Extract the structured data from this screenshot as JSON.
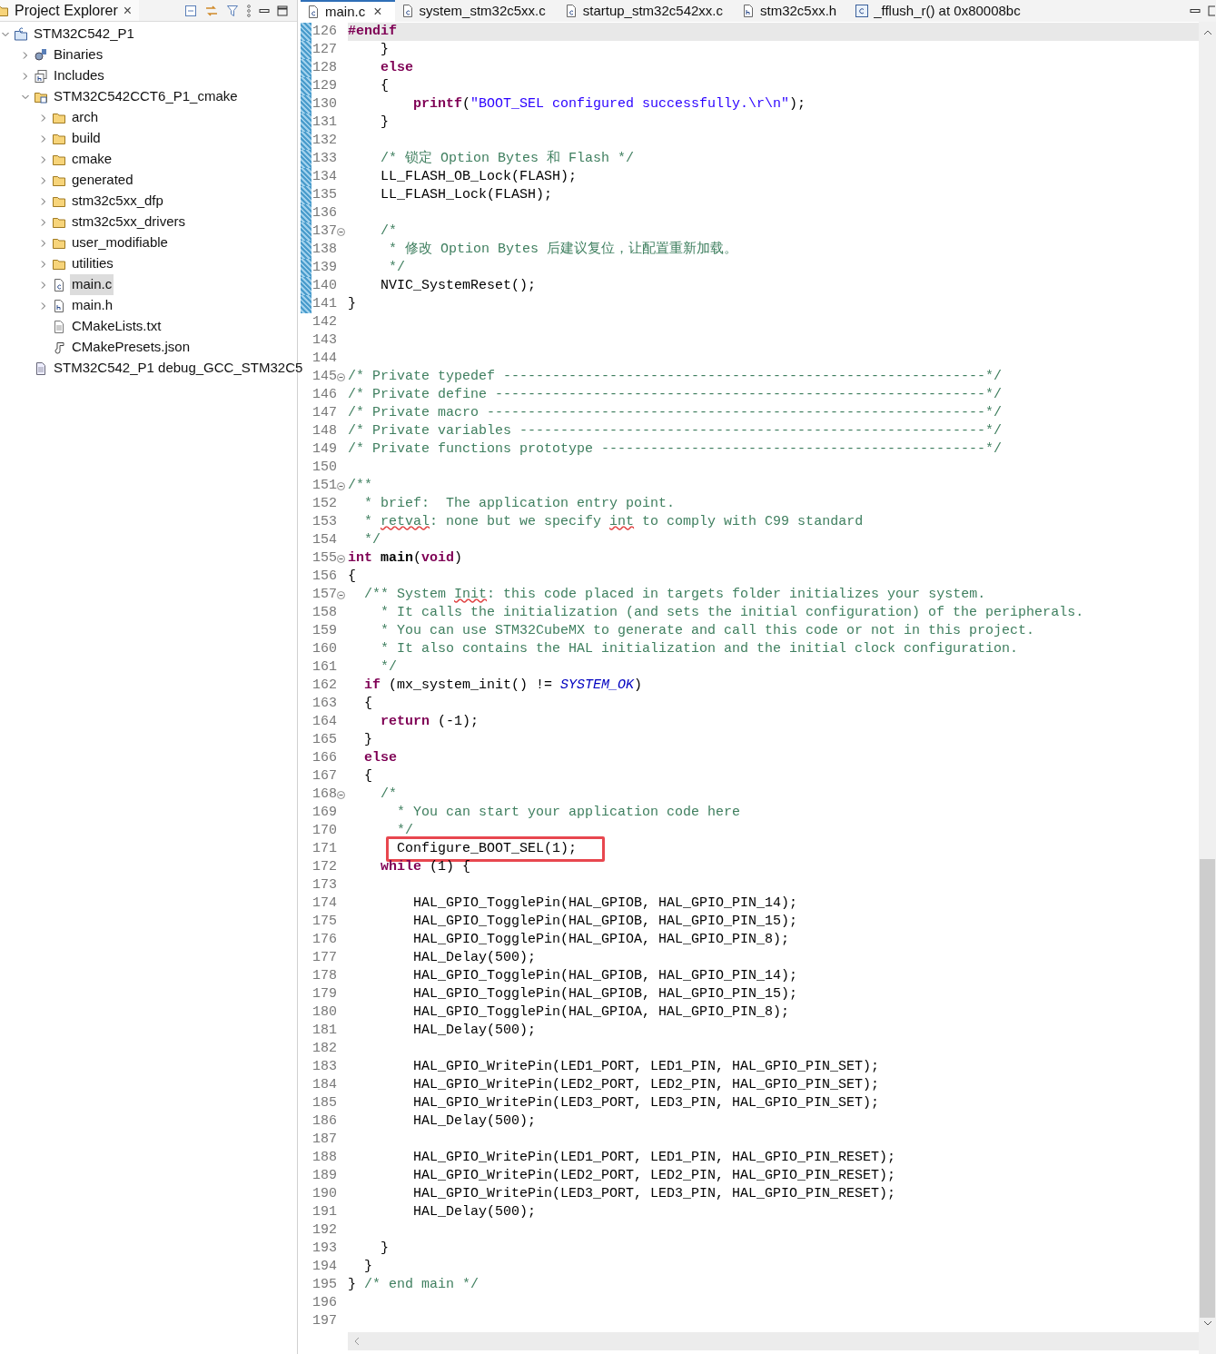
{
  "explorer": {
    "title": "Project Explorer",
    "close": "×",
    "tree": [
      {
        "label": "STM32C542_P1",
        "kind": "project",
        "expanded": true,
        "selected": false,
        "children": [
          {
            "label": "Binaries",
            "kind": "binaries",
            "expanded": false,
            "selected": false
          },
          {
            "label": "Includes",
            "kind": "includes",
            "expanded": false,
            "selected": false
          },
          {
            "label": "STM32C542CCT6_P1_cmake",
            "kind": "source-folder",
            "expanded": true,
            "selected": false,
            "children": [
              {
                "label": "arch",
                "kind": "folder",
                "expanded": false,
                "selected": false
              },
              {
                "label": "build",
                "kind": "folder",
                "expanded": false,
                "selected": false
              },
              {
                "label": "cmake",
                "kind": "folder",
                "expanded": false,
                "selected": false
              },
              {
                "label": "generated",
                "kind": "folder",
                "expanded": false,
                "selected": false
              },
              {
                "label": "stm32c5xx_dfp",
                "kind": "folder",
                "expanded": false,
                "selected": false
              },
              {
                "label": "stm32c5xx_drivers",
                "kind": "folder",
                "expanded": false,
                "selected": false
              },
              {
                "label": "user_modifiable",
                "kind": "folder",
                "expanded": false,
                "selected": false
              },
              {
                "label": "utilities",
                "kind": "folder",
                "expanded": false,
                "selected": false
              },
              {
                "label": "main.c",
                "kind": "c-file",
                "expanded": false,
                "selected": true
              },
              {
                "label": "main.h",
                "kind": "h-file",
                "expanded": false,
                "selected": false
              },
              {
                "label": "CMakeLists.txt",
                "kind": "text-file",
                "selected": false
              },
              {
                "label": "CMakePresets.json",
                "kind": "json-file",
                "selected": false
              }
            ]
          },
          {
            "label": "STM32C542_P1 debug_GCC_STM32C5",
            "kind": "launch-file",
            "selected": false
          }
        ]
      }
    ]
  },
  "editor": {
    "tabs": [
      {
        "label": "main.c",
        "kind": "c-file",
        "selected": true,
        "close": "×"
      },
      {
        "label": "system_stm32c5xx.c",
        "kind": "c-file",
        "selected": false
      },
      {
        "label": "startup_stm32c542xx.c",
        "kind": "c-file",
        "selected": false
      },
      {
        "label": "stm32c5xx.h",
        "kind": "h-file",
        "selected": false
      },
      {
        "label": "_fflush_r() at 0x80008bc",
        "kind": "disassembly",
        "selected": false
      }
    ],
    "lines": [
      {
        "n": "126",
        "fold": false,
        "changed": true,
        "current": true,
        "boxed": false,
        "tokens": [
          {
            "kind": "keyword",
            "text": "#endif"
          }
        ]
      },
      {
        "n": "127",
        "fold": false,
        "changed": true,
        "current": false,
        "boxed": false,
        "tokens": [
          {
            "kind": "plain",
            "text": "    }"
          }
        ]
      },
      {
        "n": "128",
        "fold": false,
        "changed": true,
        "current": false,
        "boxed": false,
        "tokens": [
          {
            "kind": "keyword",
            "text": "    else"
          }
        ]
      },
      {
        "n": "129",
        "fold": false,
        "changed": true,
        "current": false,
        "boxed": false,
        "tokens": [
          {
            "kind": "plain",
            "text": "    {"
          }
        ]
      },
      {
        "n": "130",
        "fold": false,
        "changed": true,
        "current": false,
        "boxed": false,
        "tokens": [
          {
            "kind": "keyword",
            "text": "        printf"
          },
          {
            "kind": "plain",
            "text": "("
          },
          {
            "kind": "string",
            "text": "\"BOOT_SEL configured successfully.\\r\\n\""
          },
          {
            "kind": "plain",
            "text": ");"
          }
        ]
      },
      {
        "n": "131",
        "fold": false,
        "changed": true,
        "current": false,
        "boxed": false,
        "tokens": [
          {
            "kind": "plain",
            "text": "    }"
          }
        ]
      },
      {
        "n": "132",
        "fold": false,
        "changed": true,
        "current": false,
        "boxed": false
      },
      {
        "n": "133",
        "fold": false,
        "changed": true,
        "current": false,
        "boxed": false,
        "tokens": [
          {
            "kind": "comment",
            "text": "    /* 锁定 Option Bytes 和 Flash */"
          }
        ]
      },
      {
        "n": "134",
        "fold": false,
        "changed": true,
        "current": false,
        "boxed": false,
        "tokens": [
          {
            "kind": "plain",
            "text": "    LL_FLASH_OB_Lock(FLASH);"
          }
        ]
      },
      {
        "n": "135",
        "fold": false,
        "changed": true,
        "current": false,
        "boxed": false,
        "tokens": [
          {
            "kind": "plain",
            "text": "    LL_FLASH_Lock(FLASH);"
          }
        ]
      },
      {
        "n": "136",
        "fold": false,
        "changed": true,
        "current": false,
        "boxed": false
      },
      {
        "n": "137",
        "fold": true,
        "changed": true,
        "current": false,
        "boxed": false,
        "tokens": [
          {
            "kind": "comment",
            "text": "    /*"
          }
        ]
      },
      {
        "n": "138",
        "fold": false,
        "changed": true,
        "current": false,
        "boxed": false,
        "tokens": [
          {
            "kind": "comment",
            "text": "     * 修改 Option Bytes 后建议复位，让配置重新加载。"
          }
        ]
      },
      {
        "n": "139",
        "fold": false,
        "changed": true,
        "current": false,
        "boxed": false,
        "tokens": [
          {
            "kind": "comment",
            "text": "     */"
          }
        ]
      },
      {
        "n": "140",
        "fold": false,
        "changed": true,
        "current": false,
        "boxed": false,
        "tokens": [
          {
            "kind": "plain",
            "text": "    NVIC_SystemReset();"
          }
        ]
      },
      {
        "n": "141",
        "fold": false,
        "changed": true,
        "current": false,
        "boxed": false,
        "tokens": [
          {
            "kind": "plain",
            "text": "}"
          }
        ]
      },
      {
        "n": "142",
        "fold": false,
        "changed": false,
        "current": false,
        "boxed": false
      },
      {
        "n": "143",
        "fold": false,
        "changed": false,
        "current": false,
        "boxed": false
      },
      {
        "n": "144",
        "fold": false,
        "changed": false,
        "current": false,
        "boxed": false
      },
      {
        "n": "145",
        "fold": true,
        "changed": false,
        "current": false,
        "boxed": false,
        "tokens": [
          {
            "kind": "comment",
            "text": "/* Private typedef -----------------------------------------------------------*/"
          }
        ]
      },
      {
        "n": "146",
        "fold": false,
        "changed": false,
        "current": false,
        "boxed": false,
        "tokens": [
          {
            "kind": "comment",
            "text": "/* Private define ------------------------------------------------------------*/"
          }
        ]
      },
      {
        "n": "147",
        "fold": false,
        "changed": false,
        "current": false,
        "boxed": false,
        "tokens": [
          {
            "kind": "comment",
            "text": "/* Private macro -------------------------------------------------------------*/"
          }
        ]
      },
      {
        "n": "148",
        "fold": false,
        "changed": false,
        "current": false,
        "boxed": false,
        "tokens": [
          {
            "kind": "comment",
            "text": "/* Private variables ---------------------------------------------------------*/"
          }
        ]
      },
      {
        "n": "149",
        "fold": false,
        "changed": false,
        "current": false,
        "boxed": false,
        "tokens": [
          {
            "kind": "comment",
            "text": "/* Private functions prototype -----------------------------------------------*/"
          }
        ]
      },
      {
        "n": "150",
        "fold": false,
        "changed": false,
        "current": false,
        "boxed": false
      },
      {
        "n": "151",
        "fold": true,
        "changed": false,
        "current": false,
        "boxed": false,
        "tokens": [
          {
            "kind": "comment",
            "text": "/**"
          }
        ]
      },
      {
        "n": "152",
        "fold": false,
        "changed": false,
        "current": false,
        "boxed": false,
        "tokens": [
          {
            "kind": "comment",
            "text": "  * brief:  The application entry point."
          }
        ]
      },
      {
        "n": "153",
        "fold": false,
        "changed": false,
        "current": false,
        "boxed": false,
        "tokens": [
          {
            "kind": "comment",
            "text": "  * "
          },
          {
            "kind": "typo",
            "text": "retval"
          },
          {
            "kind": "comment",
            "text": ": none but we specify "
          },
          {
            "kind": "typo",
            "text": "int"
          },
          {
            "kind": "comment",
            "text": " to comply with C99 standard"
          }
        ]
      },
      {
        "n": "154",
        "fold": false,
        "changed": false,
        "current": false,
        "boxed": false,
        "tokens": [
          {
            "kind": "comment",
            "text": "  */"
          }
        ]
      },
      {
        "n": "155",
        "fold": true,
        "changed": false,
        "current": false,
        "boxed": false,
        "tokens": [
          {
            "kind": "keyword",
            "text": "int"
          },
          {
            "kind": "function",
            "text": " main"
          },
          {
            "kind": "plain",
            "text": "("
          },
          {
            "kind": "keyword",
            "text": "void"
          },
          {
            "kind": "plain",
            "text": ")"
          }
        ]
      },
      {
        "n": "156",
        "fold": false,
        "changed": false,
        "current": false,
        "boxed": false,
        "tokens": [
          {
            "kind": "plain",
            "text": "{"
          }
        ]
      },
      {
        "n": "157",
        "fold": true,
        "changed": false,
        "current": false,
        "boxed": false,
        "tokens": [
          {
            "kind": "comment",
            "text": "  /** System "
          },
          {
            "kind": "typo",
            "text": "Init"
          },
          {
            "kind": "comment",
            "text": ": this code placed in targets folder initializes your system."
          }
        ]
      },
      {
        "n": "158",
        "fold": false,
        "changed": false,
        "current": false,
        "boxed": false,
        "tokens": [
          {
            "kind": "comment",
            "text": "    * It calls the initialization (and sets the initial configuration) of the peripherals."
          }
        ]
      },
      {
        "n": "159",
        "fold": false,
        "changed": false,
        "current": false,
        "boxed": false,
        "tokens": [
          {
            "kind": "comment",
            "text": "    * You can use STM32CubeMX to generate and call this code or not in this project."
          }
        ]
      },
      {
        "n": "160",
        "fold": false,
        "changed": false,
        "current": false,
        "boxed": false,
        "tokens": [
          {
            "kind": "comment",
            "text": "    * It also contains the HAL initialization and the initial clock configuration."
          }
        ]
      },
      {
        "n": "161",
        "fold": false,
        "changed": false,
        "current": false,
        "boxed": false,
        "tokens": [
          {
            "kind": "comment",
            "text": "    */"
          }
        ]
      },
      {
        "n": "162",
        "fold": false,
        "changed": false,
        "current": false,
        "boxed": false,
        "tokens": [
          {
            "kind": "keyword",
            "text": "  if"
          },
          {
            "kind": "plain",
            "text": " (mx_system_init() != "
          },
          {
            "kind": "constant",
            "text": "SYSTEM_OK"
          },
          {
            "kind": "plain",
            "text": ")"
          }
        ]
      },
      {
        "n": "163",
        "fold": false,
        "changed": false,
        "current": false,
        "boxed": false,
        "tokens": [
          {
            "kind": "plain",
            "text": "  {"
          }
        ]
      },
      {
        "n": "164",
        "fold": false,
        "changed": false,
        "current": false,
        "boxed": false,
        "tokens": [
          {
            "kind": "keyword",
            "text": "    return"
          },
          {
            "kind": "plain",
            "text": " (-1);"
          }
        ]
      },
      {
        "n": "165",
        "fold": false,
        "changed": false,
        "current": false,
        "boxed": false,
        "tokens": [
          {
            "kind": "plain",
            "text": "  }"
          }
        ]
      },
      {
        "n": "166",
        "fold": false,
        "changed": false,
        "current": false,
        "boxed": false,
        "tokens": [
          {
            "kind": "keyword",
            "text": "  else"
          }
        ]
      },
      {
        "n": "167",
        "fold": false,
        "changed": false,
        "current": false,
        "boxed": false,
        "tokens": [
          {
            "kind": "plain",
            "text": "  {"
          }
        ]
      },
      {
        "n": "168",
        "fold": true,
        "changed": false,
        "current": false,
        "boxed": false,
        "tokens": [
          {
            "kind": "comment",
            "text": "    /*"
          }
        ]
      },
      {
        "n": "169",
        "fold": false,
        "changed": false,
        "current": false,
        "boxed": false,
        "tokens": [
          {
            "kind": "comment",
            "text": "      * You can start your application code here"
          }
        ]
      },
      {
        "n": "170",
        "fold": false,
        "changed": false,
        "current": false,
        "boxed": false,
        "tokens": [
          {
            "kind": "comment",
            "text": "      */"
          }
        ]
      },
      {
        "n": "171",
        "fold": false,
        "changed": false,
        "current": false,
        "boxed": true,
        "tokens": [
          {
            "kind": "plain",
            "text": "      Configure_BOOT_SEL(1);"
          }
        ]
      },
      {
        "n": "172",
        "fold": false,
        "changed": false,
        "current": false,
        "boxed": false,
        "tokens": [
          {
            "kind": "keyword",
            "text": "    while"
          },
          {
            "kind": "plain",
            "text": " (1) {"
          }
        ]
      },
      {
        "n": "173",
        "fold": false,
        "changed": false,
        "current": false,
        "boxed": false
      },
      {
        "n": "174",
        "fold": false,
        "changed": false,
        "current": false,
        "boxed": false,
        "tokens": [
          {
            "kind": "plain",
            "text": "        HAL_GPIO_TogglePin(HAL_GPIOB, HAL_GPIO_PIN_14);"
          }
        ]
      },
      {
        "n": "175",
        "fold": false,
        "changed": false,
        "current": false,
        "boxed": false,
        "tokens": [
          {
            "kind": "plain",
            "text": "        HAL_GPIO_TogglePin(HAL_GPIOB, HAL_GPIO_PIN_15);"
          }
        ]
      },
      {
        "n": "176",
        "fold": false,
        "changed": false,
        "current": false,
        "boxed": false,
        "tokens": [
          {
            "kind": "plain",
            "text": "        HAL_GPIO_TogglePin(HAL_GPIOA, HAL_GPIO_PIN_8);"
          }
        ]
      },
      {
        "n": "177",
        "fold": false,
        "changed": false,
        "current": false,
        "boxed": false,
        "tokens": [
          {
            "kind": "plain",
            "text": "        HAL_Delay(500);"
          }
        ]
      },
      {
        "n": "178",
        "fold": false,
        "changed": false,
        "current": false,
        "boxed": false,
        "tokens": [
          {
            "kind": "plain",
            "text": "        HAL_GPIO_TogglePin(HAL_GPIOB, HAL_GPIO_PIN_14);"
          }
        ]
      },
      {
        "n": "179",
        "fold": false,
        "changed": false,
        "current": false,
        "boxed": false,
        "tokens": [
          {
            "kind": "plain",
            "text": "        HAL_GPIO_TogglePin(HAL_GPIOB, HAL_GPIO_PIN_15);"
          }
        ]
      },
      {
        "n": "180",
        "fold": false,
        "changed": false,
        "current": false,
        "boxed": false,
        "tokens": [
          {
            "kind": "plain",
            "text": "        HAL_GPIO_TogglePin(HAL_GPIOA, HAL_GPIO_PIN_8);"
          }
        ]
      },
      {
        "n": "181",
        "fold": false,
        "changed": false,
        "current": false,
        "boxed": false,
        "tokens": [
          {
            "kind": "plain",
            "text": "        HAL_Delay(500);"
          }
        ]
      },
      {
        "n": "182",
        "fold": false,
        "changed": false,
        "current": false,
        "boxed": false
      },
      {
        "n": "183",
        "fold": false,
        "changed": false,
        "current": false,
        "boxed": false,
        "tokens": [
          {
            "kind": "plain",
            "text": "        HAL_GPIO_WritePin(LED1_PORT, LED1_PIN, HAL_GPIO_PIN_SET);"
          }
        ]
      },
      {
        "n": "184",
        "fold": false,
        "changed": false,
        "current": false,
        "boxed": false,
        "tokens": [
          {
            "kind": "plain",
            "text": "        HAL_GPIO_WritePin(LED2_PORT, LED2_PIN, HAL_GPIO_PIN_SET);"
          }
        ]
      },
      {
        "n": "185",
        "fold": false,
        "changed": false,
        "current": false,
        "boxed": false,
        "tokens": [
          {
            "kind": "plain",
            "text": "        HAL_GPIO_WritePin(LED3_PORT, LED3_PIN, HAL_GPIO_PIN_SET);"
          }
        ]
      },
      {
        "n": "186",
        "fold": false,
        "changed": false,
        "current": false,
        "boxed": false,
        "tokens": [
          {
            "kind": "plain",
            "text": "        HAL_Delay(500);"
          }
        ]
      },
      {
        "n": "187",
        "fold": false,
        "changed": false,
        "current": false,
        "boxed": false
      },
      {
        "n": "188",
        "fold": false,
        "changed": false,
        "current": false,
        "boxed": false,
        "tokens": [
          {
            "kind": "plain",
            "text": "        HAL_GPIO_WritePin(LED1_PORT, LED1_PIN, HAL_GPIO_PIN_RESET);"
          }
        ]
      },
      {
        "n": "189",
        "fold": false,
        "changed": false,
        "current": false,
        "boxed": false,
        "tokens": [
          {
            "kind": "plain",
            "text": "        HAL_GPIO_WritePin(LED2_PORT, LED2_PIN, HAL_GPIO_PIN_RESET);"
          }
        ]
      },
      {
        "n": "190",
        "fold": false,
        "changed": false,
        "current": false,
        "boxed": false,
        "tokens": [
          {
            "kind": "plain",
            "text": "        HAL_GPIO_WritePin(LED3_PORT, LED3_PIN, HAL_GPIO_PIN_RESET);"
          }
        ]
      },
      {
        "n": "191",
        "fold": false,
        "changed": false,
        "current": false,
        "boxed": false,
        "tokens": [
          {
            "kind": "plain",
            "text": "        HAL_Delay(500);"
          }
        ]
      },
      {
        "n": "192",
        "fold": false,
        "changed": false,
        "current": false,
        "boxed": false
      },
      {
        "n": "193",
        "fold": false,
        "changed": false,
        "current": false,
        "boxed": false,
        "tokens": [
          {
            "kind": "plain",
            "text": "    }"
          }
        ]
      },
      {
        "n": "194",
        "fold": false,
        "changed": false,
        "current": false,
        "boxed": false,
        "tokens": [
          {
            "kind": "plain",
            "text": "  }"
          }
        ]
      },
      {
        "n": "195",
        "fold": false,
        "changed": false,
        "current": false,
        "boxed": false,
        "tokens": [
          {
            "kind": "plain",
            "text": "} "
          },
          {
            "kind": "comment",
            "text": "/* end main */"
          }
        ]
      },
      {
        "n": "196",
        "fold": false,
        "changed": false,
        "current": false,
        "boxed": false
      },
      {
        "n": "197",
        "fold": false,
        "changed": false,
        "current": false,
        "boxed": false
      }
    ]
  }
}
